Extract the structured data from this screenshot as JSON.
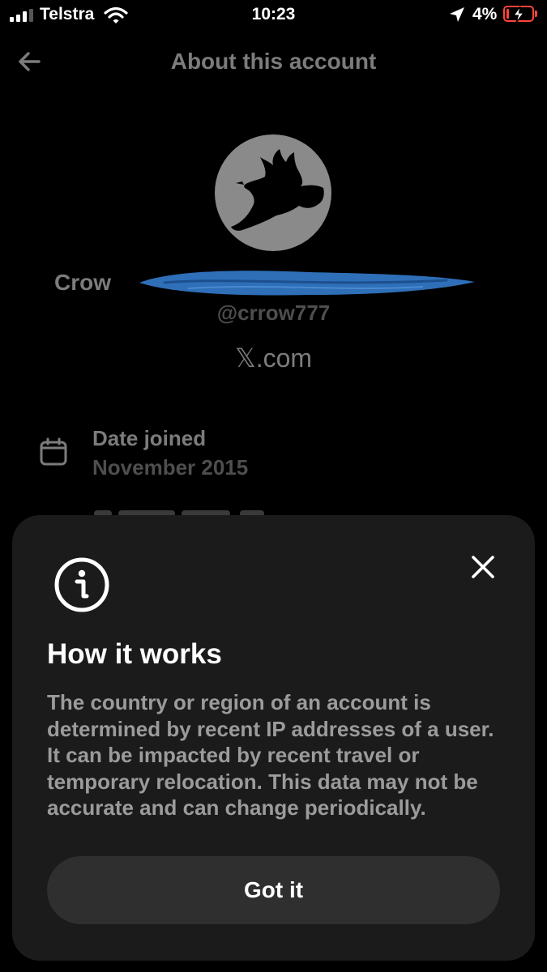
{
  "status_bar": {
    "carrier": "Telstra",
    "time": "10:23",
    "battery_percent": "4%",
    "battery_level": 0.04,
    "icons": [
      "signal-icon",
      "wifi-icon",
      "location-arrow-icon",
      "battery-charging-icon"
    ]
  },
  "header": {
    "title": "About this account",
    "back_icon": "back-arrow-icon"
  },
  "profile": {
    "avatar": "crow-avatar",
    "name": "Crow",
    "handle": "@crrow777",
    "site": "𝕏.com"
  },
  "details": {
    "date_joined_label": "Date joined",
    "date_joined_value": "November 2015",
    "icon": "calendar-icon"
  },
  "sheet": {
    "icon": "info-icon",
    "close_icon": "close-icon",
    "title": "How it works",
    "body": "The country or region of an account is determined by recent IP addresses of a user. It can be impacted by recent travel or temporary relocation. This data may not be accurate and can change periodically.",
    "button_label": "Got it"
  },
  "colors": {
    "background": "#000000",
    "sheet": "#1b1b1b",
    "button": "#2f2f2f",
    "dim_text": "#7c7c7c",
    "battery_low": "#ff453a",
    "redaction": "#2e6fb8"
  }
}
